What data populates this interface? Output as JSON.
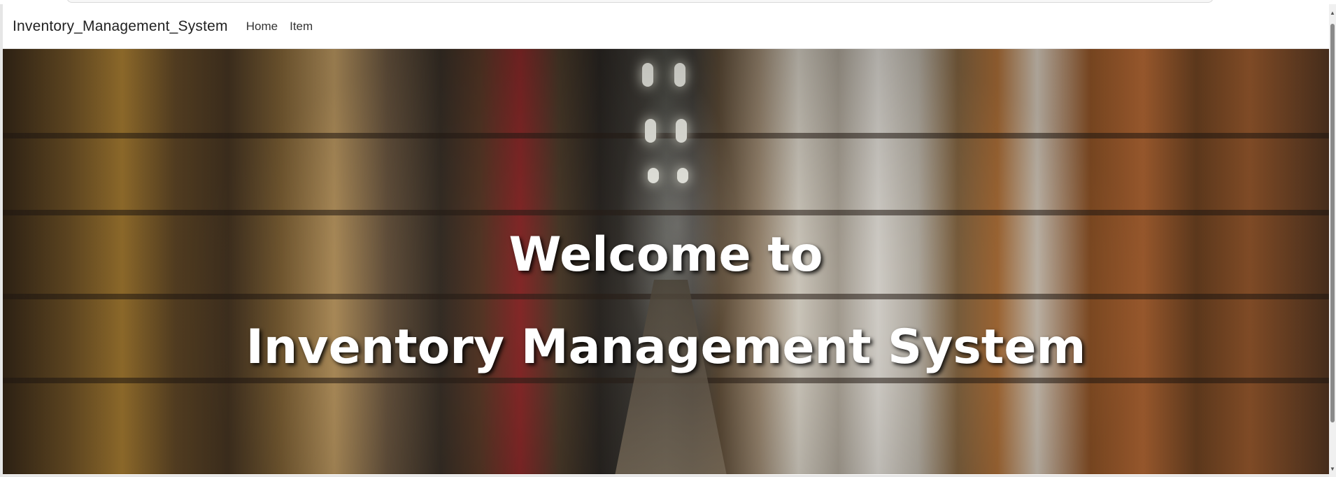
{
  "navbar": {
    "brand": "Inventory_Management_System",
    "links": [
      "Home",
      "Item"
    ]
  },
  "hero": {
    "line1": "Welcome to",
    "line2": "Inventory Management System"
  },
  "scrollbar": {
    "up_icon": "▲",
    "down_icon": "▼"
  },
  "colors": {
    "hero_text": "#ffffff",
    "navbar_bg": "#ffffff",
    "brand_text": "#222222"
  }
}
